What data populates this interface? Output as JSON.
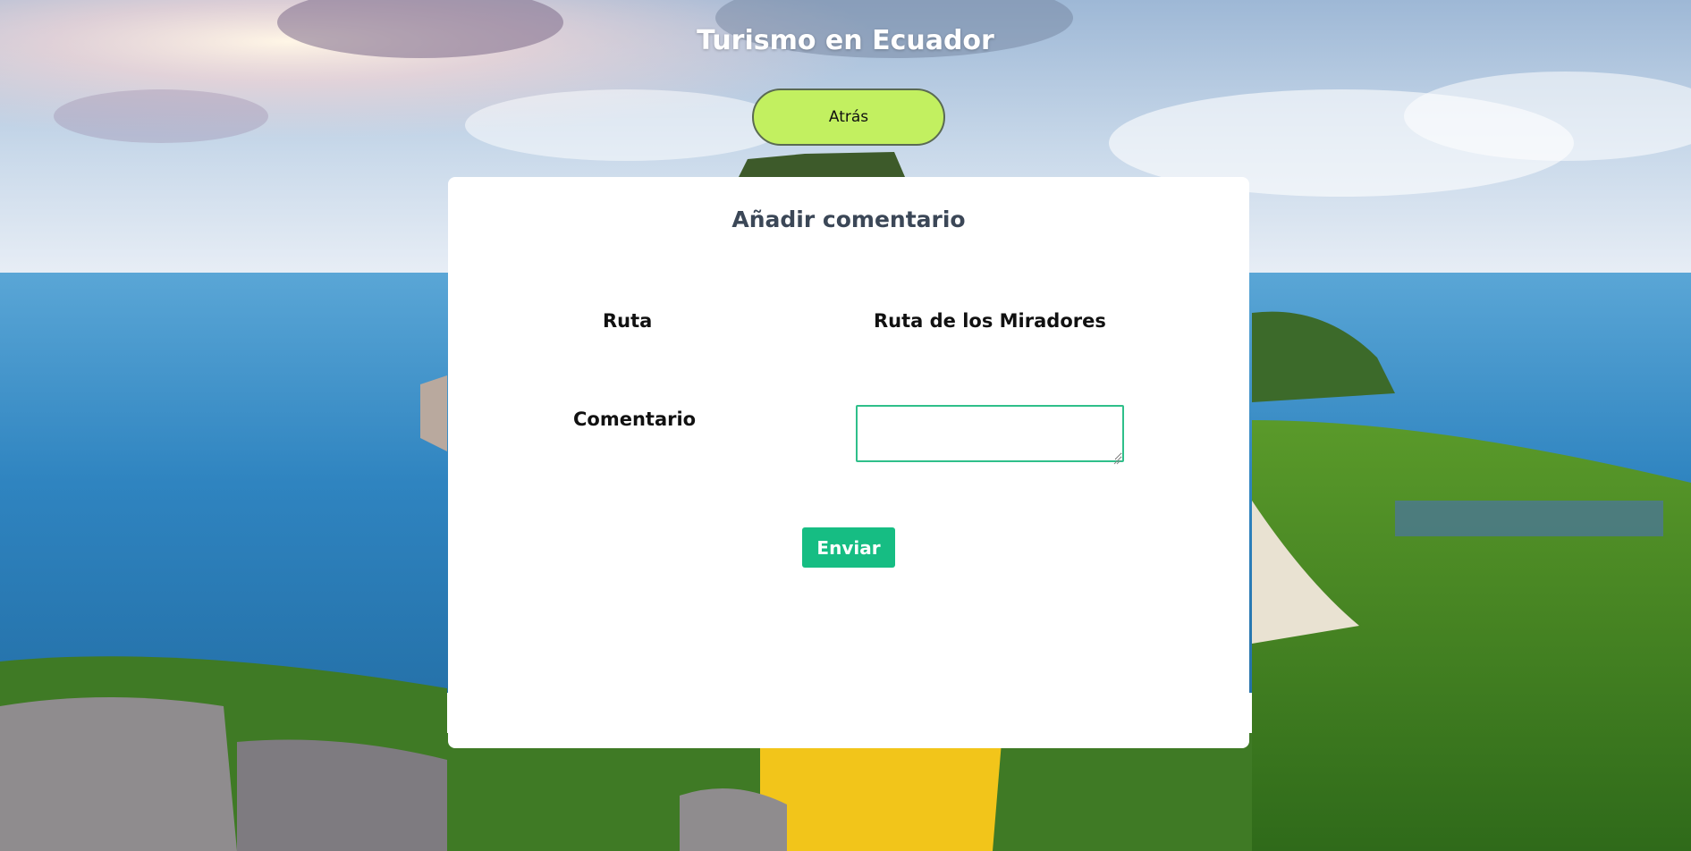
{
  "header": {
    "title": "Turismo en Ecuador",
    "back_label": "Atrás"
  },
  "form": {
    "title": "Añadir comentario",
    "route_label": "Ruta",
    "route_value": "Ruta de los Miradores",
    "comment_label": "Comentario",
    "comment_value": "",
    "submit_label": "Enviar"
  },
  "colors": {
    "back_button": "#c2f060",
    "submit_button": "#16bd83",
    "comment_border": "#2fbf8a",
    "card_title": "#3b4757"
  }
}
